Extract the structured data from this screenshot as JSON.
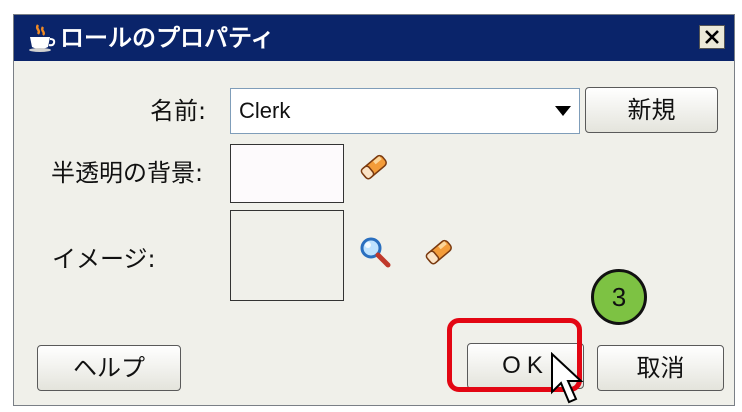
{
  "window": {
    "title": "ロールのプロパティ",
    "title_icon": "java-cup-icon",
    "close_icon": "close-icon"
  },
  "form": {
    "name_label": "名前:",
    "name_value": "Clerk",
    "new_button_label": "新規",
    "translucent_bg_label": "半透明の背景:",
    "translucent_bg_color": "#fdfafc",
    "image_label": "イメージ:"
  },
  "footer": {
    "help_button_label": "ヘルプ",
    "ok_button_label": "OK",
    "cancel_button_label": "取消"
  },
  "annotation": {
    "step_number": "3",
    "highlight_color": "#e30613",
    "badge_color": "#7dc243"
  },
  "colors": {
    "titlebar": "#0a246a",
    "dialog_bg": "#f0f0ea"
  },
  "icons": [
    "java-cup-icon",
    "close-icon",
    "dropdown-arrow-icon",
    "eraser-icon",
    "magnifier-icon",
    "mouse-cursor-icon"
  ]
}
